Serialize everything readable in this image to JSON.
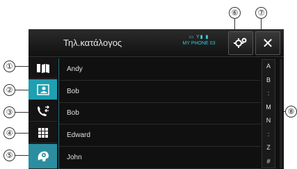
{
  "header": {
    "title": "Τηλ.κατάλογος",
    "status_icons": "▭ Y▮ ▮",
    "device_name": "MY PHONE 03",
    "settings_icon": "gear-icon",
    "close_label": "✕"
  },
  "sidebar": {
    "items": [
      {
        "icon": "phonebook-icon"
      },
      {
        "icon": "contact-card-icon",
        "active": true
      },
      {
        "icon": "call-history-icon"
      },
      {
        "icon": "keypad-icon"
      },
      {
        "icon": "voice-recognition-icon"
      }
    ]
  },
  "contacts": [
    "Andy",
    "Bob",
    "Bob",
    "Edward",
    "John"
  ],
  "alpha_index": [
    "A",
    "B",
    ":",
    "M",
    "N",
    ":",
    "Z",
    "#"
  ],
  "callouts": [
    "①",
    "②",
    "③",
    "④",
    "⑤",
    "⑥",
    "⑦",
    "⑧"
  ],
  "colors": {
    "accent": "#1f9fb0",
    "status": "#2ec8d8"
  }
}
